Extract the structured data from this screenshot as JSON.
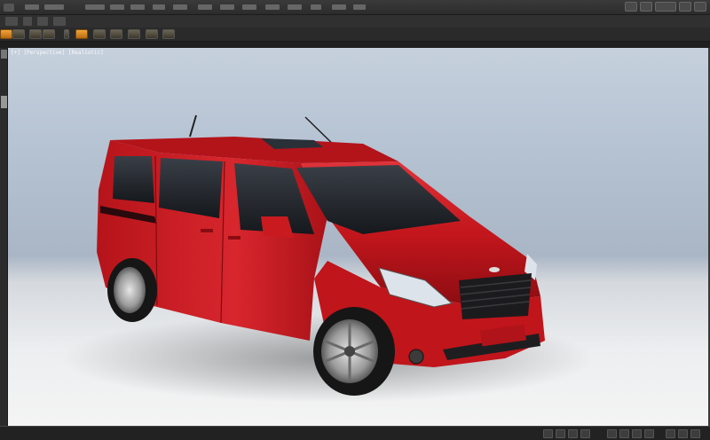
{
  "menubar": {
    "items": [
      "",
      "",
      "",
      "",
      "",
      "",
      "",
      "",
      "",
      "",
      "",
      "",
      "",
      ""
    ]
  },
  "viewport": {
    "label": "[+] [Perspective] [Realistic]"
  },
  "colors": {
    "car_body": "#cc1a1f",
    "accent": "#f2a53a"
  }
}
